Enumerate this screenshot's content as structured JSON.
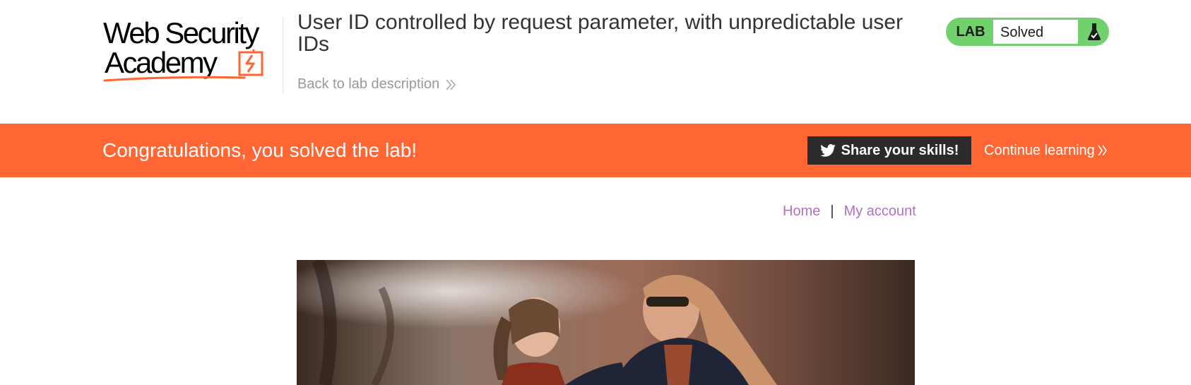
{
  "logo": {
    "line1": "Web Security",
    "line2": "Academy"
  },
  "header": {
    "title": "User ID controlled by request parameter, with unpredictable user IDs",
    "back_link": "Back to lab description"
  },
  "lab": {
    "tag": "LAB",
    "status": "Solved",
    "icon": "flask-check-icon"
  },
  "banner": {
    "message": "Congratulations, you solved the lab!",
    "share_label": "Share your skills!",
    "continue_label": "Continue learning"
  },
  "nav": {
    "home": "Home",
    "separator": "|",
    "account": "My account"
  },
  "colors": {
    "accent_orange": "#ff6633",
    "lab_green": "#70d16d",
    "link_purple": "#b06fc4",
    "dark_button": "#2b2b2b"
  }
}
